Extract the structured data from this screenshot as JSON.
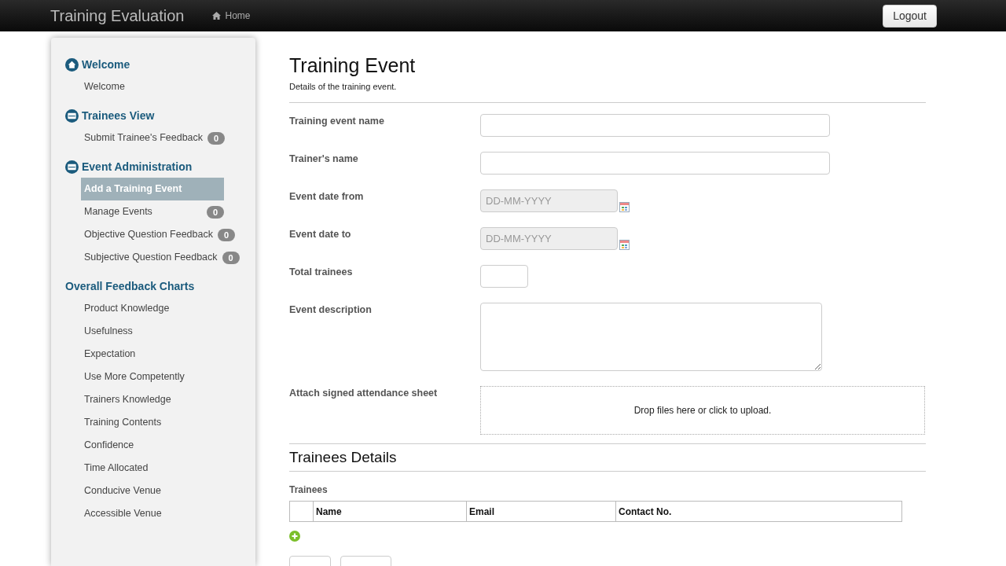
{
  "navbar": {
    "brand": "Training Evaluation",
    "home": "Home",
    "logout": "Logout"
  },
  "sidebar": {
    "sections": [
      {
        "title": "Welcome",
        "kind": "home",
        "items": [
          {
            "label": "Welcome",
            "selected": false
          }
        ]
      },
      {
        "title": "Trainees View",
        "kind": "list",
        "items": [
          {
            "label": "Submit Trainee's Feedback",
            "selected": false,
            "badge": "0"
          }
        ]
      },
      {
        "title": "Event Administration",
        "kind": "list",
        "items": [
          {
            "label": "Add a Training Event",
            "selected": true
          },
          {
            "label": "Manage Events",
            "selected": false,
            "badge": "0"
          },
          {
            "label": "Objective Question Feedback",
            "selected": false,
            "badge": "0"
          },
          {
            "label": "Subjective Question Feedback",
            "selected": false,
            "badge": "0"
          }
        ]
      },
      {
        "title": "Overall Feedback Charts",
        "kind": "plain",
        "items": [
          {
            "label": "Product Knowledge",
            "selected": false
          },
          {
            "label": "Usefulness",
            "selected": false
          },
          {
            "label": "Expectation",
            "selected": false
          },
          {
            "label": "Use More Competently",
            "selected": false
          },
          {
            "label": "Trainers Knowledge",
            "selected": false
          },
          {
            "label": "Training Contents",
            "selected": false
          },
          {
            "label": "Confidence",
            "selected": false
          },
          {
            "label": "Time Allocated",
            "selected": false
          },
          {
            "label": "Conducive Venue",
            "selected": false
          },
          {
            "label": "Accessible Venue",
            "selected": false
          }
        ]
      }
    ]
  },
  "main": {
    "title": "Training Event",
    "subtitle": "Details of the training event.",
    "fields": [
      {
        "label": "Training event name",
        "kind": "text"
      },
      {
        "label": "Trainer's name",
        "kind": "text"
      },
      {
        "label": "Event date from",
        "kind": "date",
        "placeholder": "DD-MM-YYYY"
      },
      {
        "label": "Event date to",
        "kind": "date",
        "placeholder": "DD-MM-YYYY"
      },
      {
        "label": "Total trainees",
        "kind": "number"
      },
      {
        "label": "Event description",
        "kind": "textarea"
      },
      {
        "label": "Attach signed attendance sheet",
        "kind": "dropzone",
        "hint": "Drop files here or click to upload."
      }
    ],
    "section_title": "Trainees Details",
    "table_label": "Trainees",
    "table": {
      "columns": [
        "Name",
        "Email",
        "Contact No."
      ]
    }
  }
}
